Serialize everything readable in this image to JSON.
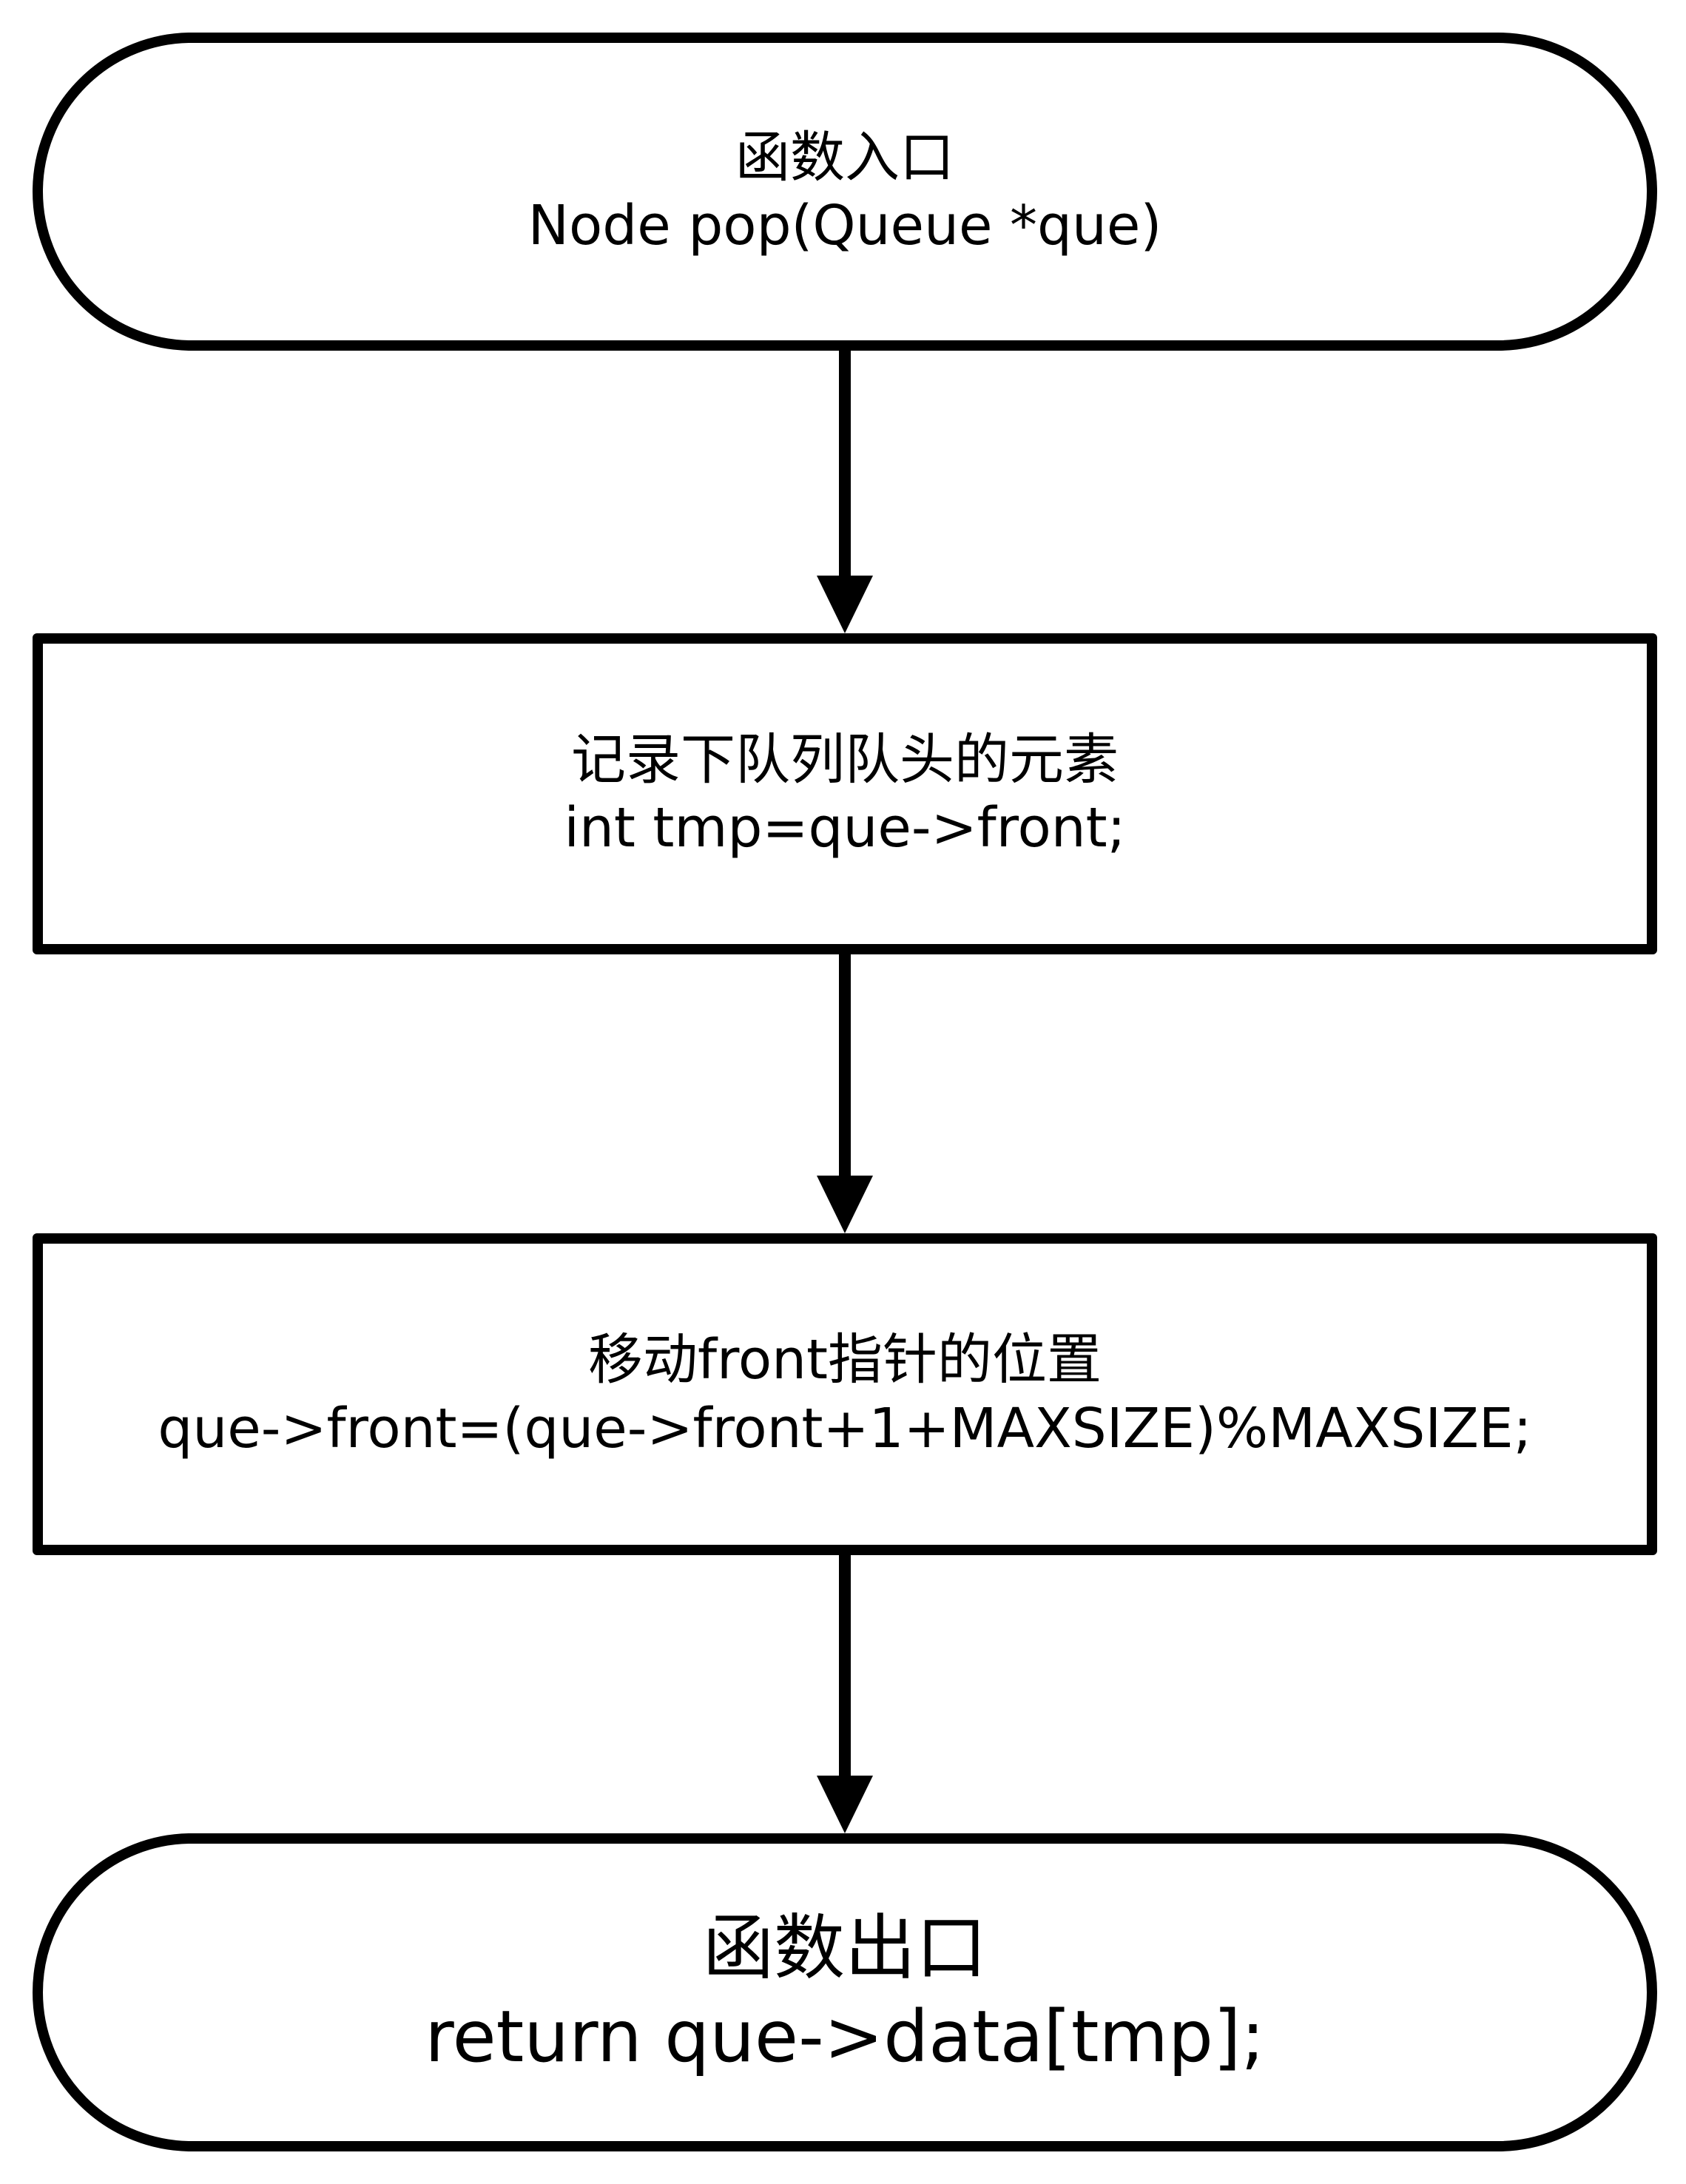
{
  "flowchart": {
    "nodes": [
      {
        "id": "start",
        "shape": "terminal",
        "lines": [
          "函数入口",
          "Node pop(Queue *que)"
        ]
      },
      {
        "id": "record",
        "shape": "process",
        "lines": [
          "记录下队列队头的元素",
          "int tmp=que->front;"
        ]
      },
      {
        "id": "move",
        "shape": "process",
        "lines": [
          "移动front指针的位置",
          "que->front=(que->front+1+MAXSIZE)%MAXSIZE;"
        ]
      },
      {
        "id": "end",
        "shape": "terminal",
        "lines": [
          "函数出口",
          "return que->data[tmp];"
        ]
      }
    ],
    "edges": [
      {
        "from": "start",
        "to": "record"
      },
      {
        "from": "record",
        "to": "move"
      },
      {
        "from": "move",
        "to": "end"
      }
    ],
    "colors": {
      "stroke": "#000000",
      "fill": "#ffffff",
      "text": "#000000"
    }
  }
}
